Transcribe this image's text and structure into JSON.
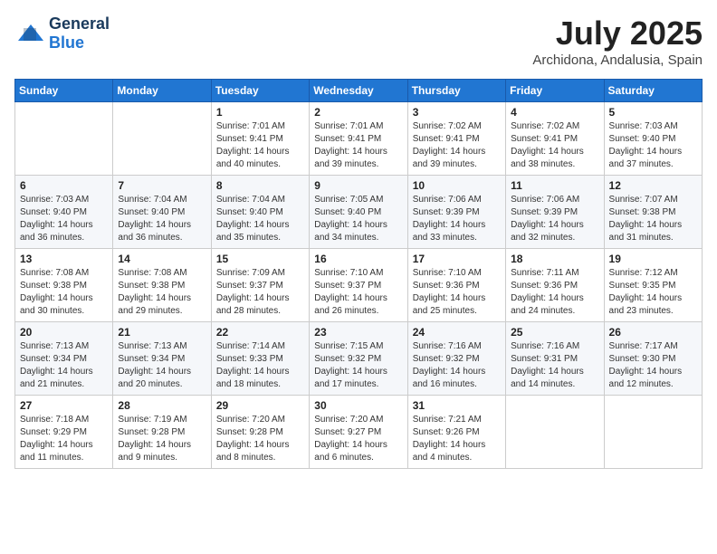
{
  "header": {
    "logo_general": "General",
    "logo_blue": "Blue",
    "month": "July 2025",
    "location": "Archidona, Andalusia, Spain"
  },
  "days_of_week": [
    "Sunday",
    "Monday",
    "Tuesday",
    "Wednesday",
    "Thursday",
    "Friday",
    "Saturday"
  ],
  "weeks": [
    [
      {
        "day": "",
        "sunrise": "",
        "sunset": "",
        "daylight": ""
      },
      {
        "day": "",
        "sunrise": "",
        "sunset": "",
        "daylight": ""
      },
      {
        "day": "1",
        "sunrise": "Sunrise: 7:01 AM",
        "sunset": "Sunset: 9:41 PM",
        "daylight": "Daylight: 14 hours and 40 minutes."
      },
      {
        "day": "2",
        "sunrise": "Sunrise: 7:01 AM",
        "sunset": "Sunset: 9:41 PM",
        "daylight": "Daylight: 14 hours and 39 minutes."
      },
      {
        "day": "3",
        "sunrise": "Sunrise: 7:02 AM",
        "sunset": "Sunset: 9:41 PM",
        "daylight": "Daylight: 14 hours and 39 minutes."
      },
      {
        "day": "4",
        "sunrise": "Sunrise: 7:02 AM",
        "sunset": "Sunset: 9:41 PM",
        "daylight": "Daylight: 14 hours and 38 minutes."
      },
      {
        "day": "5",
        "sunrise": "Sunrise: 7:03 AM",
        "sunset": "Sunset: 9:40 PM",
        "daylight": "Daylight: 14 hours and 37 minutes."
      }
    ],
    [
      {
        "day": "6",
        "sunrise": "Sunrise: 7:03 AM",
        "sunset": "Sunset: 9:40 PM",
        "daylight": "Daylight: 14 hours and 36 minutes."
      },
      {
        "day": "7",
        "sunrise": "Sunrise: 7:04 AM",
        "sunset": "Sunset: 9:40 PM",
        "daylight": "Daylight: 14 hours and 36 minutes."
      },
      {
        "day": "8",
        "sunrise": "Sunrise: 7:04 AM",
        "sunset": "Sunset: 9:40 PM",
        "daylight": "Daylight: 14 hours and 35 minutes."
      },
      {
        "day": "9",
        "sunrise": "Sunrise: 7:05 AM",
        "sunset": "Sunset: 9:40 PM",
        "daylight": "Daylight: 14 hours and 34 minutes."
      },
      {
        "day": "10",
        "sunrise": "Sunrise: 7:06 AM",
        "sunset": "Sunset: 9:39 PM",
        "daylight": "Daylight: 14 hours and 33 minutes."
      },
      {
        "day": "11",
        "sunrise": "Sunrise: 7:06 AM",
        "sunset": "Sunset: 9:39 PM",
        "daylight": "Daylight: 14 hours and 32 minutes."
      },
      {
        "day": "12",
        "sunrise": "Sunrise: 7:07 AM",
        "sunset": "Sunset: 9:38 PM",
        "daylight": "Daylight: 14 hours and 31 minutes."
      }
    ],
    [
      {
        "day": "13",
        "sunrise": "Sunrise: 7:08 AM",
        "sunset": "Sunset: 9:38 PM",
        "daylight": "Daylight: 14 hours and 30 minutes."
      },
      {
        "day": "14",
        "sunrise": "Sunrise: 7:08 AM",
        "sunset": "Sunset: 9:38 PM",
        "daylight": "Daylight: 14 hours and 29 minutes."
      },
      {
        "day": "15",
        "sunrise": "Sunrise: 7:09 AM",
        "sunset": "Sunset: 9:37 PM",
        "daylight": "Daylight: 14 hours and 28 minutes."
      },
      {
        "day": "16",
        "sunrise": "Sunrise: 7:10 AM",
        "sunset": "Sunset: 9:37 PM",
        "daylight": "Daylight: 14 hours and 26 minutes."
      },
      {
        "day": "17",
        "sunrise": "Sunrise: 7:10 AM",
        "sunset": "Sunset: 9:36 PM",
        "daylight": "Daylight: 14 hours and 25 minutes."
      },
      {
        "day": "18",
        "sunrise": "Sunrise: 7:11 AM",
        "sunset": "Sunset: 9:36 PM",
        "daylight": "Daylight: 14 hours and 24 minutes."
      },
      {
        "day": "19",
        "sunrise": "Sunrise: 7:12 AM",
        "sunset": "Sunset: 9:35 PM",
        "daylight": "Daylight: 14 hours and 23 minutes."
      }
    ],
    [
      {
        "day": "20",
        "sunrise": "Sunrise: 7:13 AM",
        "sunset": "Sunset: 9:34 PM",
        "daylight": "Daylight: 14 hours and 21 minutes."
      },
      {
        "day": "21",
        "sunrise": "Sunrise: 7:13 AM",
        "sunset": "Sunset: 9:34 PM",
        "daylight": "Daylight: 14 hours and 20 minutes."
      },
      {
        "day": "22",
        "sunrise": "Sunrise: 7:14 AM",
        "sunset": "Sunset: 9:33 PM",
        "daylight": "Daylight: 14 hours and 18 minutes."
      },
      {
        "day": "23",
        "sunrise": "Sunrise: 7:15 AM",
        "sunset": "Sunset: 9:32 PM",
        "daylight": "Daylight: 14 hours and 17 minutes."
      },
      {
        "day": "24",
        "sunrise": "Sunrise: 7:16 AM",
        "sunset": "Sunset: 9:32 PM",
        "daylight": "Daylight: 14 hours and 16 minutes."
      },
      {
        "day": "25",
        "sunrise": "Sunrise: 7:16 AM",
        "sunset": "Sunset: 9:31 PM",
        "daylight": "Daylight: 14 hours and 14 minutes."
      },
      {
        "day": "26",
        "sunrise": "Sunrise: 7:17 AM",
        "sunset": "Sunset: 9:30 PM",
        "daylight": "Daylight: 14 hours and 12 minutes."
      }
    ],
    [
      {
        "day": "27",
        "sunrise": "Sunrise: 7:18 AM",
        "sunset": "Sunset: 9:29 PM",
        "daylight": "Daylight: 14 hours and 11 minutes."
      },
      {
        "day": "28",
        "sunrise": "Sunrise: 7:19 AM",
        "sunset": "Sunset: 9:28 PM",
        "daylight": "Daylight: 14 hours and 9 minutes."
      },
      {
        "day": "29",
        "sunrise": "Sunrise: 7:20 AM",
        "sunset": "Sunset: 9:28 PM",
        "daylight": "Daylight: 14 hours and 8 minutes."
      },
      {
        "day": "30",
        "sunrise": "Sunrise: 7:20 AM",
        "sunset": "Sunset: 9:27 PM",
        "daylight": "Daylight: 14 hours and 6 minutes."
      },
      {
        "day": "31",
        "sunrise": "Sunrise: 7:21 AM",
        "sunset": "Sunset: 9:26 PM",
        "daylight": "Daylight: 14 hours and 4 minutes."
      },
      {
        "day": "",
        "sunrise": "",
        "sunset": "",
        "daylight": ""
      },
      {
        "day": "",
        "sunrise": "",
        "sunset": "",
        "daylight": ""
      }
    ]
  ]
}
